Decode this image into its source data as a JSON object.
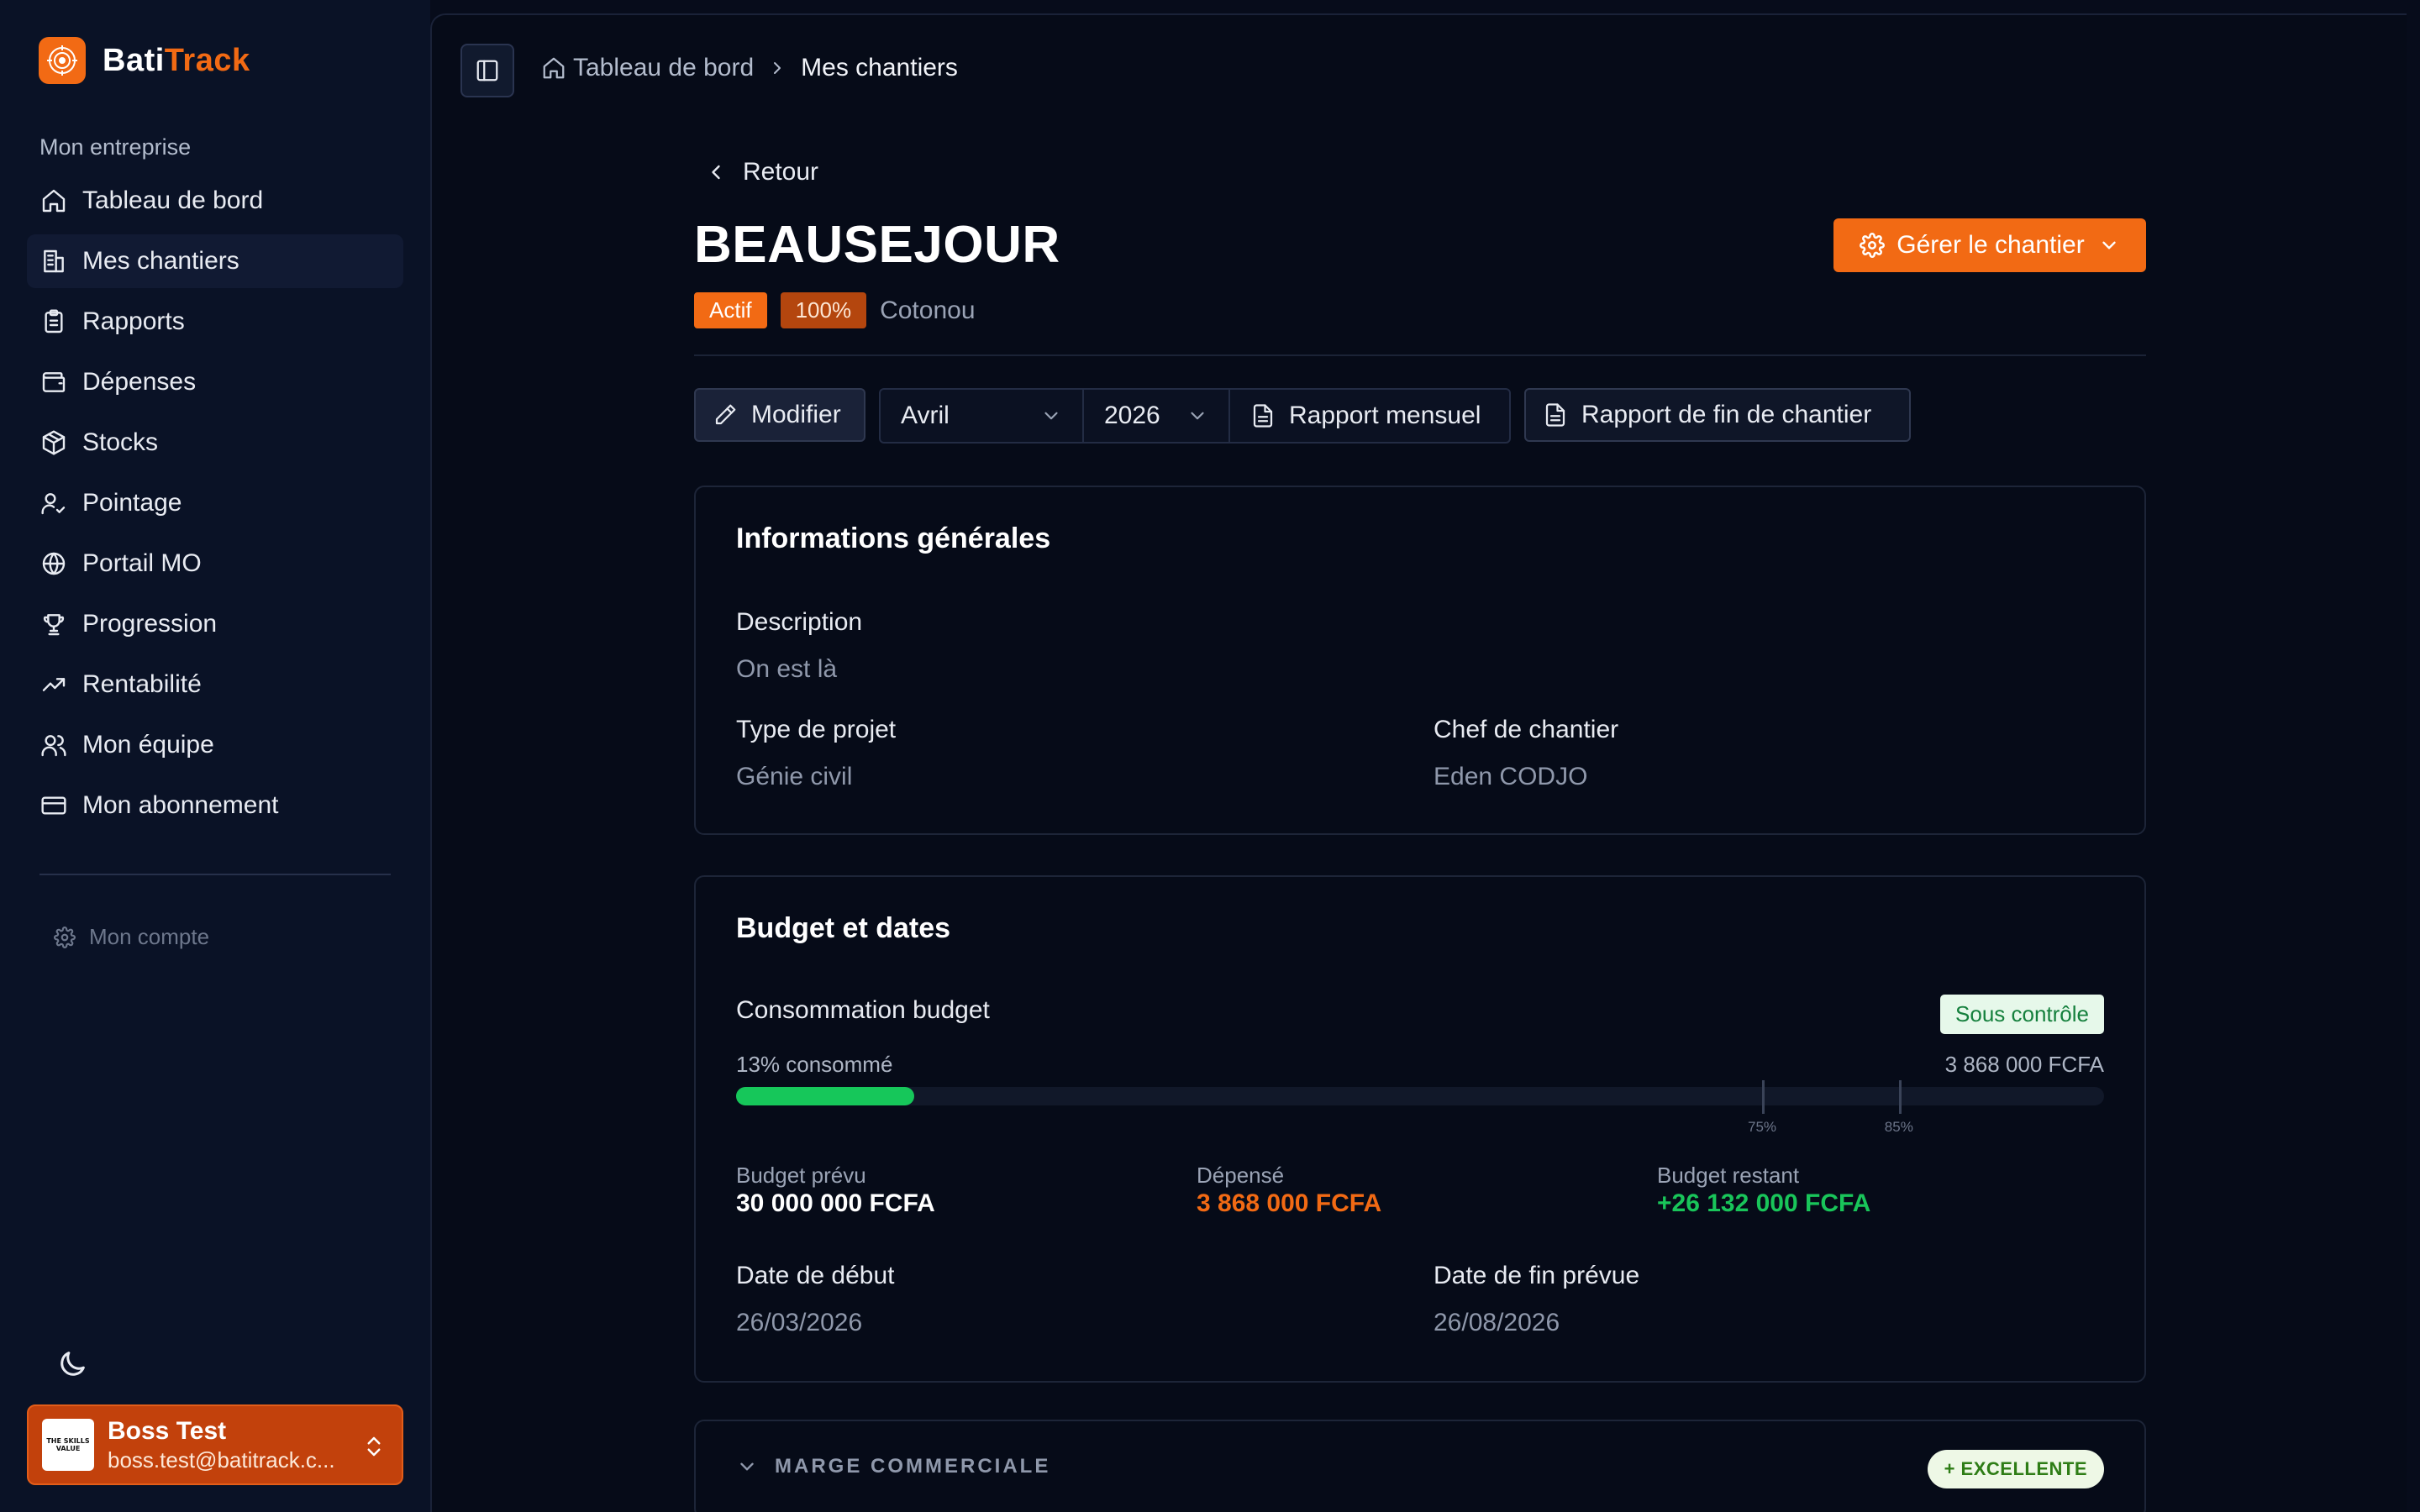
{
  "brand": {
    "part1": "Bati",
    "part2": "Track",
    "accent": "#f26a14"
  },
  "sidebar": {
    "section_label": "Mon entreprise",
    "items": [
      {
        "label": "Tableau de bord",
        "icon": "home-icon",
        "active": false
      },
      {
        "label": "Mes chantiers",
        "icon": "building-icon",
        "active": true
      },
      {
        "label": "Rapports",
        "icon": "clipboard-icon",
        "active": false
      },
      {
        "label": "Dépenses",
        "icon": "wallet-icon",
        "active": false
      },
      {
        "label": "Stocks",
        "icon": "box-icon",
        "active": false
      },
      {
        "label": "Pointage",
        "icon": "user-check-icon",
        "active": false
      },
      {
        "label": "Portail MO",
        "icon": "globe-icon",
        "active": false
      },
      {
        "label": "Progression",
        "icon": "trophy-icon",
        "active": false
      },
      {
        "label": "Rentabilité",
        "icon": "trending-up-icon",
        "active": false
      },
      {
        "label": "Mon équipe",
        "icon": "users-icon",
        "active": false
      },
      {
        "label": "Mon abonnement",
        "icon": "credit-card-icon",
        "active": false
      }
    ],
    "account_label": "Mon compte",
    "user": {
      "name": "Boss Test",
      "email": "boss.test@batitrack.c...",
      "avatar_text": "THE SKILLS VALUE"
    }
  },
  "breadcrumb": {
    "home": "Tableau de bord",
    "current": "Mes chantiers"
  },
  "header": {
    "back_label": "Retour",
    "title": "BEAUSEJOUR",
    "status": "Actif",
    "progress": "100%",
    "city": "Cotonou",
    "manage_label": "Gérer le chantier"
  },
  "toolbar": {
    "modify_label": "Modifier",
    "month": "Avril",
    "year": "2026",
    "monthly_report_label": "Rapport mensuel",
    "end_report_label": "Rapport de fin de chantier"
  },
  "info": {
    "title": "Informations générales",
    "description_label": "Description",
    "description_value": "On est là",
    "type_label": "Type de projet",
    "type_value": "Génie civil",
    "chef_label": "Chef de chantier",
    "chef_value": "Eden CODJO"
  },
  "budget": {
    "title": "Budget et dates",
    "consumption_label": "Consommation budget",
    "status_badge": "Sous contrôle",
    "consumed_label": "13% consommé",
    "consumed_fraction": 0.13,
    "spent_total": "3 868 000 FCFA",
    "thresholds": [
      {
        "value": 0.75,
        "label": "75%"
      },
      {
        "value": 0.85,
        "label": "85%"
      }
    ],
    "planned_label": "Budget prévu",
    "planned_value": "30 000 000 FCFA",
    "spent_label": "Dépensé",
    "spent_value": "3 868 000 FCFA",
    "remaining_label": "Budget restant",
    "remaining_value": "+26 132 000 FCFA",
    "start_label": "Date de début",
    "start_value": "26/03/2026",
    "end_label": "Date de fin prévue",
    "end_value": "26/08/2026"
  },
  "margin": {
    "label": "MARGE COMMERCIALE",
    "badge": "+ EXCELLENTE"
  }
}
